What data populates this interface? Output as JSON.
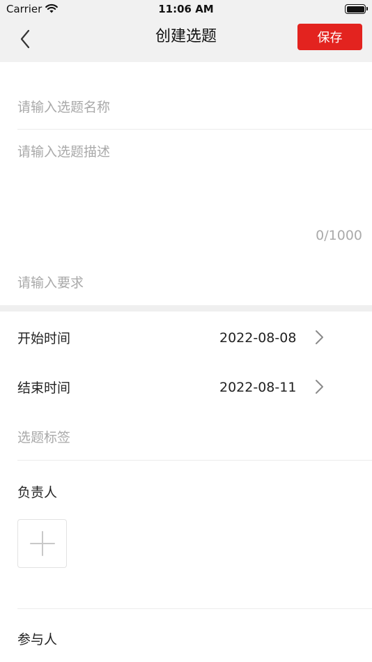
{
  "status_bar": {
    "carrier": "Carrier",
    "time": "11:06 AM"
  },
  "nav": {
    "title": "创建选题",
    "save_label": "保存",
    "accent_color": "#e3231f"
  },
  "form": {
    "name_placeholder": "请输入选题名称",
    "description_placeholder": "请输入选题描述",
    "description_counter": "0/1000",
    "requirement_placeholder": "请输入要求",
    "start_time": {
      "label": "开始时间",
      "value": "2022-08-08"
    },
    "end_time": {
      "label": "结束时间",
      "value": "2022-08-11"
    },
    "tags_placeholder": "选题标签",
    "owner_label": "负责人",
    "participants_label": "参与人"
  },
  "icons": {
    "back": "chevron-left-icon",
    "row_arrow": "chevron-right-icon",
    "add": "plus-icon",
    "wifi": "wifi-icon",
    "battery": "battery-icon"
  }
}
